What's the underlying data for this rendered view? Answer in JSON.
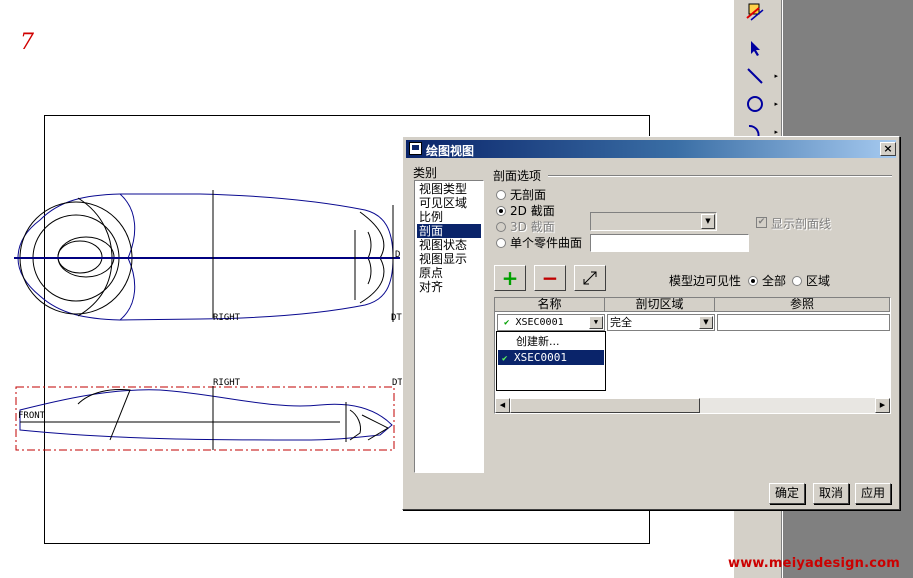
{
  "page_number": "7",
  "watermark": "www.meiyadesign.com",
  "drawing": {
    "label_right_top": "RIGHT",
    "label_right_bottom": "RIGHT",
    "label_front": "FRONT",
    "label_dt_top": "DT",
    "label_dt_bottom": "DT",
    "label_d": "D"
  },
  "toolbar": {
    "tools": [
      "sketch-icon",
      "select-arrow-icon",
      "line-icon",
      "circle-icon",
      "arc-icon"
    ]
  },
  "dialog": {
    "title": "绘图视图",
    "close": "×",
    "category_label": "类别",
    "categories": [
      "视图类型",
      "可见区域",
      "比例",
      "剖面",
      "视图状态",
      "视图显示",
      "原点",
      "对齐"
    ],
    "selected_category": "剖面",
    "section_options_label": "剖面选项",
    "radio_none": "无剖面",
    "radio_2d": "2D 截面",
    "radio_3d": "3D 截面",
    "radio_single": "单个零件曲面",
    "show_hatch_label": "显示剖面线",
    "add_symbol": "+",
    "remove_symbol": "−",
    "model_edge_label": "模型边可见性",
    "radio_all": "全部",
    "radio_area": "区域",
    "col_name": "名称",
    "col_cut_area": "剖切区域",
    "col_reference": "参照",
    "row_name": "XSEC0001",
    "row_cut_area": "完全",
    "popup_items": [
      "创建新...",
      "XSEC0001"
    ],
    "btn_ok": "确定",
    "btn_cancel": "取消",
    "btn_apply": "应用",
    "accent": "#0a246a"
  }
}
